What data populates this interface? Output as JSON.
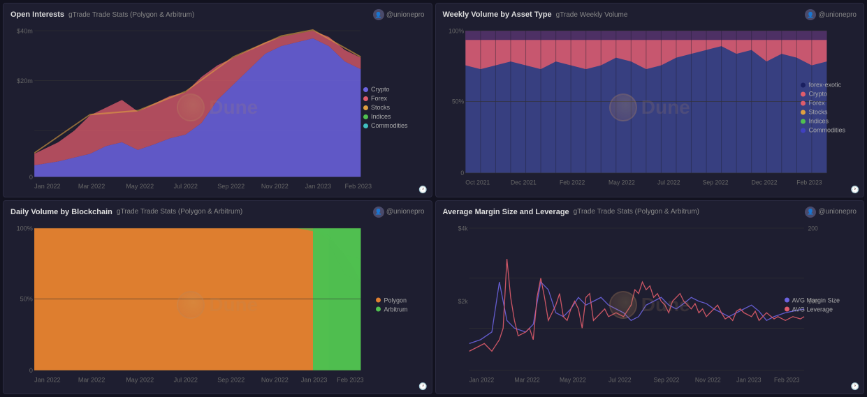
{
  "charts": [
    {
      "id": "open-interests",
      "title": "Open Interests",
      "subtitle": "gTrade Trade Stats (Polygon & Arbitrum)",
      "user": "@unionepro",
      "legend": [
        {
          "label": "Crypto",
          "color": "#6c63e0"
        },
        {
          "label": "Forex",
          "color": "#e05c6c"
        },
        {
          "label": "Stocks",
          "color": "#e0a040"
        },
        {
          "label": "Indices",
          "color": "#50c050"
        },
        {
          "label": "Commodities",
          "color": "#40c0c0"
        }
      ],
      "yLabels": [
        "$40m",
        "$20m",
        "0"
      ],
      "xLabels": [
        "Jan 2022",
        "Mar 2022",
        "May 2022",
        "Jul 2022",
        "Sep 2022",
        "Nov 2022",
        "Jan 2023",
        "Feb 2023"
      ],
      "type": "area-stacked"
    },
    {
      "id": "weekly-volume",
      "title": "Weekly Volume by Asset Type",
      "subtitle": "gTrade Weekly Volume",
      "user": "@unionepro",
      "legend": [
        {
          "label": "forex-exotic",
          "color": "#1a2060"
        },
        {
          "label": "Crypto",
          "color": "#e05c6c"
        },
        {
          "label": "Forex",
          "color": "#e05c6c"
        },
        {
          "label": "Stocks",
          "color": "#e0a040"
        },
        {
          "label": "Indices",
          "color": "#50c050"
        },
        {
          "label": "Commodities",
          "color": "#4040c0"
        }
      ],
      "yLabels": [
        "100%",
        "50%",
        "0"
      ],
      "xLabels": [
        "Oct 2021",
        "Dec 2021",
        "Feb 2022",
        "May 2022",
        "Jul 2022",
        "Sep 2022",
        "Dec 2022",
        "Feb 2023"
      ],
      "type": "area-stacked-pct"
    },
    {
      "id": "daily-volume-blockchain",
      "title": "Daily Volume by Blockchain",
      "subtitle": "gTrade Trade Stats (Polygon & Arbitrum)",
      "user": "@unionepro",
      "legend": [
        {
          "label": "Polygon",
          "color": "#e08030"
        },
        {
          "label": "Arbitrum",
          "color": "#50c050"
        }
      ],
      "yLabels": [
        "100%",
        "50%",
        "0"
      ],
      "xLabels": [
        "Jan 2022",
        "Mar 2022",
        "May 2022",
        "Jul 2022",
        "Sep 2022",
        "Nov 2022",
        "Jan 2023",
        "Feb 2023"
      ],
      "type": "area-stacked-pct"
    },
    {
      "id": "avg-margin",
      "title": "Average Margin Size and Leverage",
      "subtitle": "gTrade Trade Stats (Polygon & Arbitrum)",
      "user": "@unionepro",
      "legend": [
        {
          "label": "AVG Margin Size",
          "color": "#6c63e0"
        },
        {
          "label": "AVG Leverage",
          "color": "#e05c6c"
        }
      ],
      "yLabels": [
        "$4k",
        "$2k",
        ""
      ],
      "y2Labels": [
        "200",
        "100",
        ""
      ],
      "xLabels": [
        "Jan 2022",
        "Mar 2022",
        "May 2022",
        "Jul 2022",
        "Sep 2022",
        "Nov 2022",
        "Jan 2023",
        "Feb 2023"
      ],
      "type": "line-dual"
    }
  ]
}
